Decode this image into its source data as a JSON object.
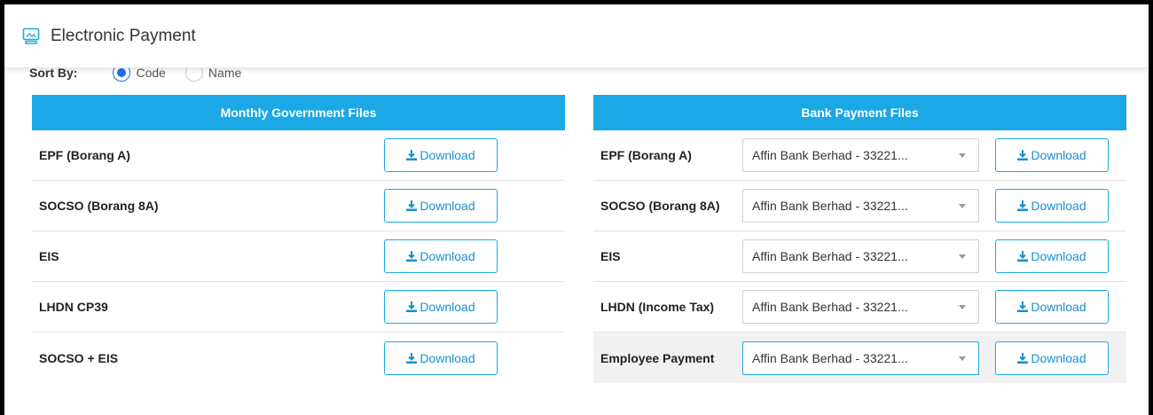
{
  "header": {
    "title": "Electronic Payment",
    "icon": "monitor-icon"
  },
  "sort": {
    "label": "Sort By:",
    "options": [
      {
        "label": "Code",
        "checked": true
      },
      {
        "label": "Name",
        "checked": false
      }
    ]
  },
  "government": {
    "title": "Monthly Government Files",
    "rows": [
      {
        "name": "EPF (Borang A)",
        "button": "Download"
      },
      {
        "name": "SOCSO (Borang 8A)",
        "button": "Download"
      },
      {
        "name": "EIS",
        "button": "Download"
      },
      {
        "name": "LHDN CP39",
        "button": "Download"
      },
      {
        "name": "SOCSO + EIS",
        "button": "Download"
      }
    ]
  },
  "bank": {
    "title": "Bank Payment Files",
    "rows": [
      {
        "name": "EPF (Borang A)",
        "select": "Affin Bank Berhad - 33221...",
        "button": "Download"
      },
      {
        "name": "SOCSO (Borang 8A)",
        "select": "Affin Bank Berhad - 33221...",
        "button": "Download"
      },
      {
        "name": "EIS",
        "select": "Affin Bank Berhad - 33221...",
        "button": "Download"
      },
      {
        "name": "LHDN (Income Tax)",
        "select": "Affin Bank Berhad - 33221...",
        "button": "Download"
      },
      {
        "name": "Employee Payment",
        "select": "Affin Bank Berhad - 33221...",
        "button": "Download"
      }
    ]
  },
  "colors": {
    "accent": "#1aa8e6",
    "link": "#1a8fd0",
    "radio": "#1a73e8"
  }
}
